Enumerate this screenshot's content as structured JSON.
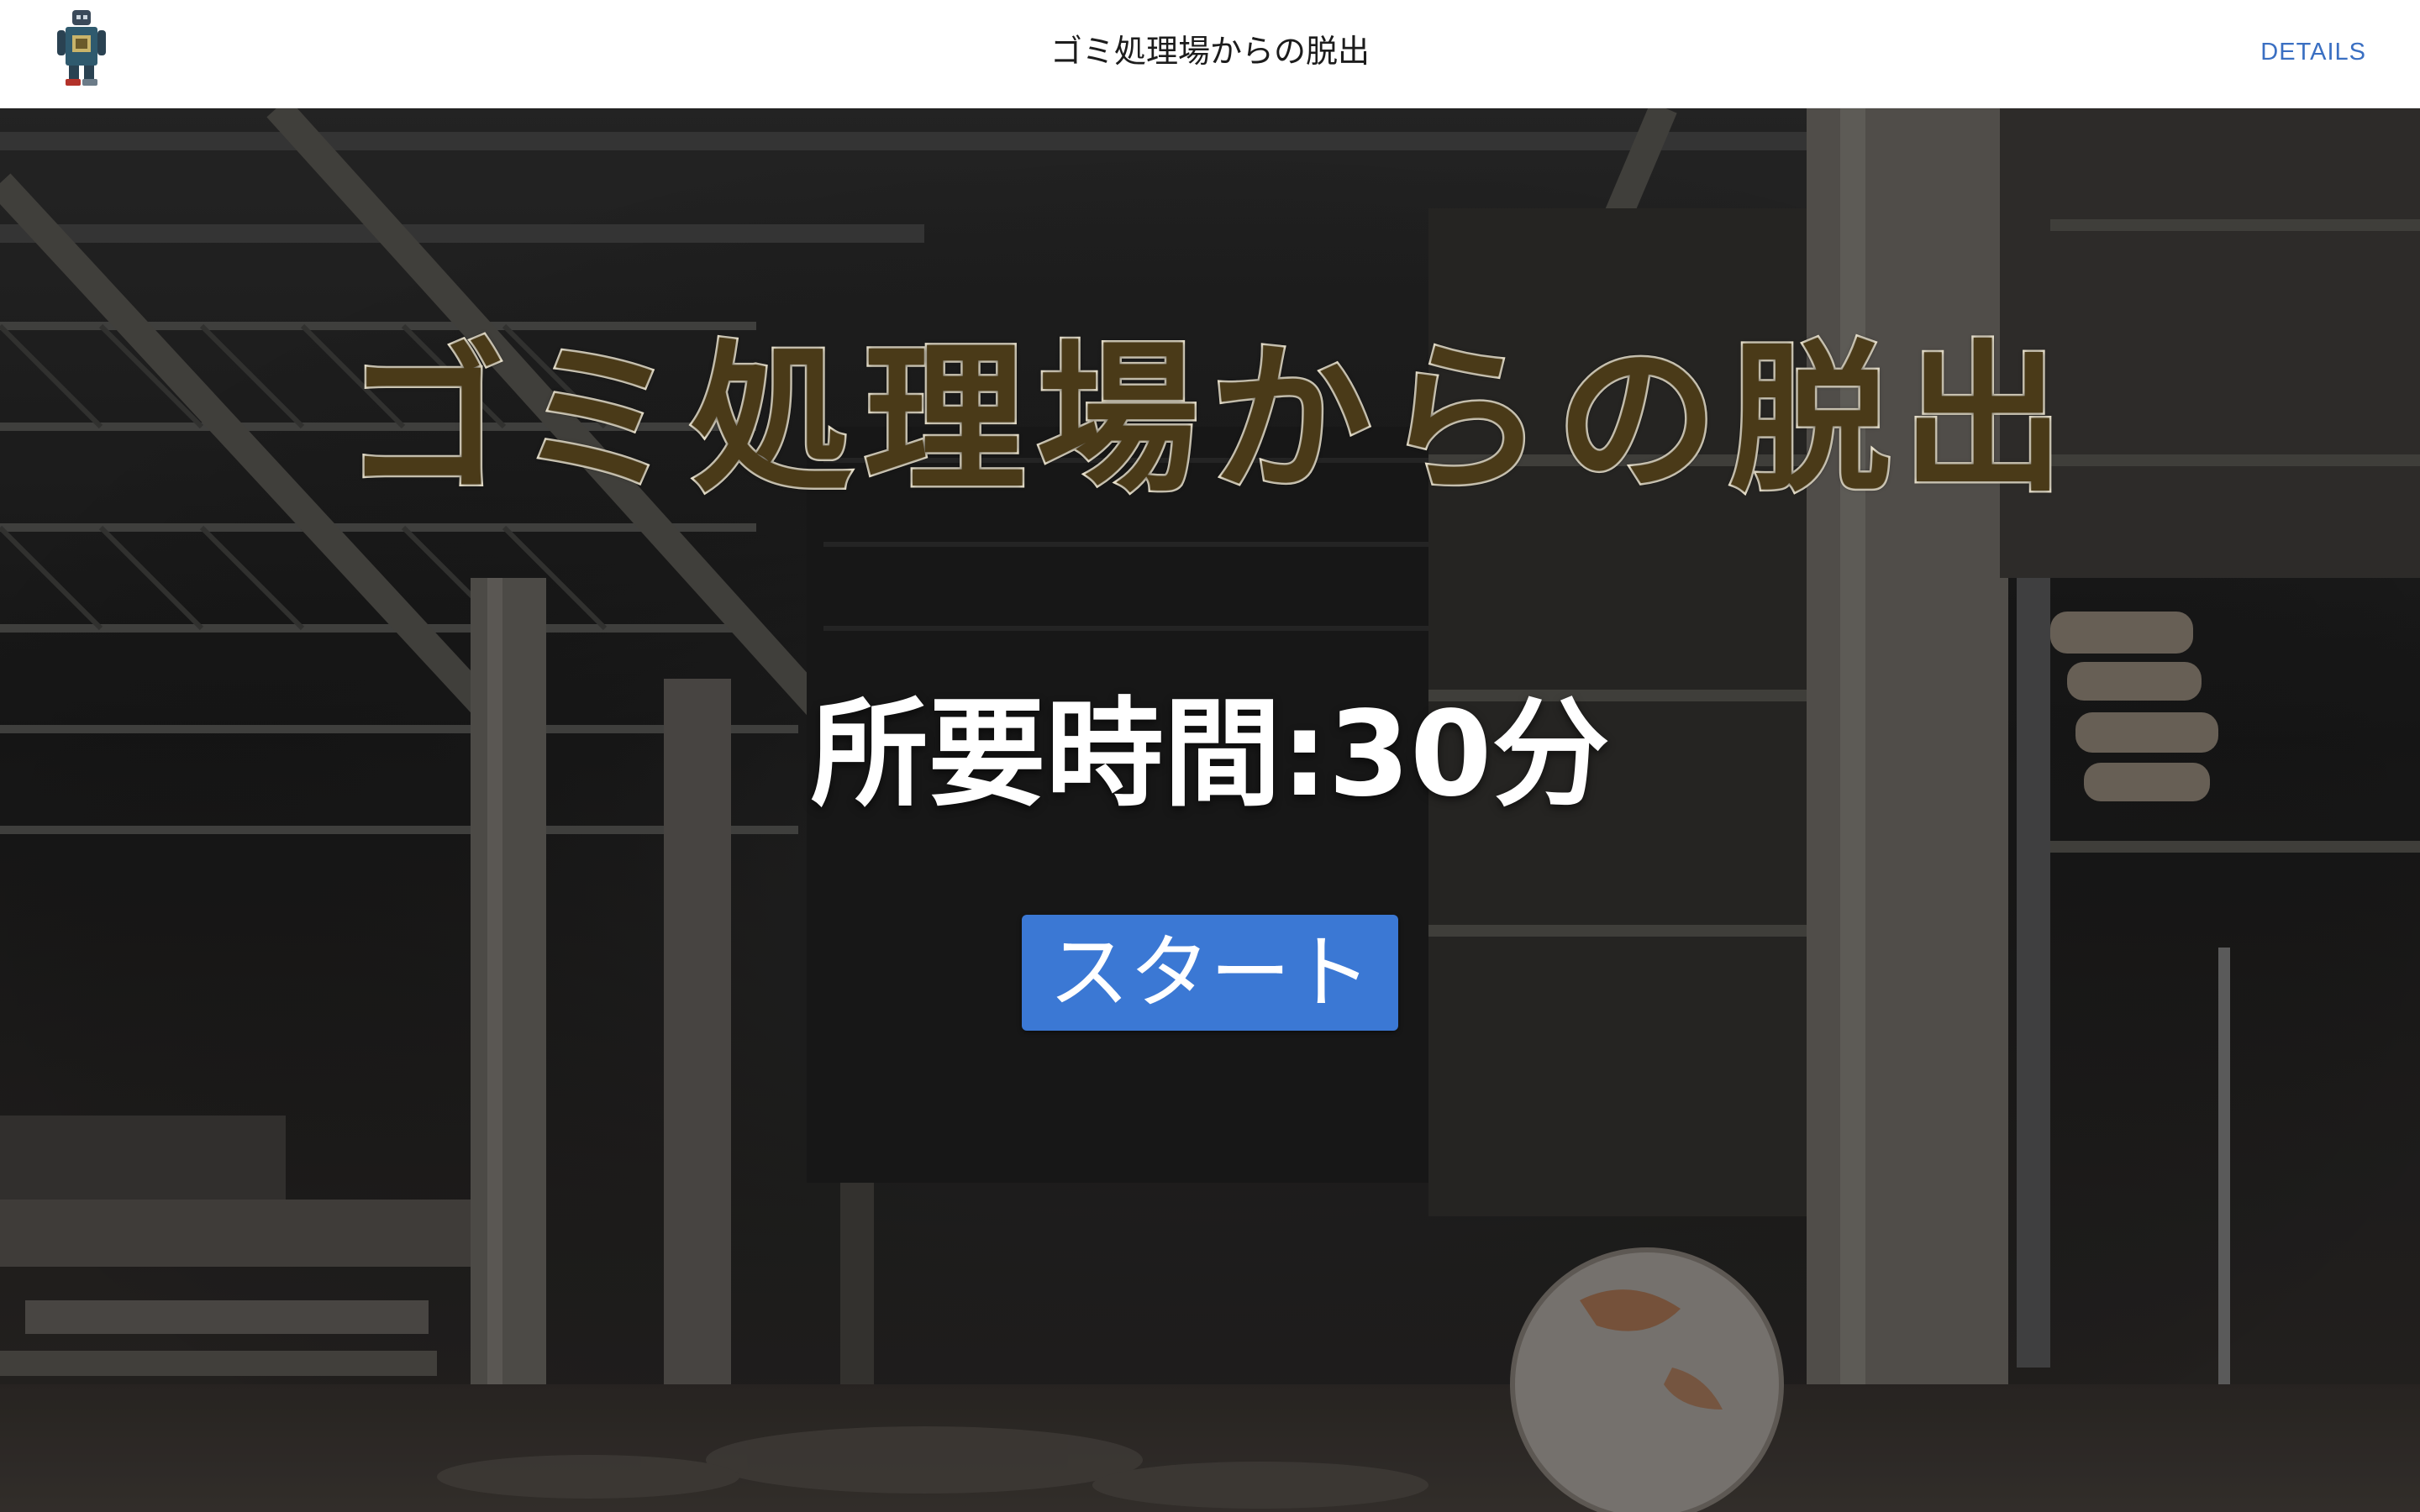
{
  "header": {
    "title": "ゴミ処理場からの脱出",
    "details_label": "DETAILS",
    "app_icon": "robot-icon"
  },
  "main": {
    "game_title": "ゴミ処理場からの脱出",
    "duration_text": "所要時間:30分",
    "start_label": "スタート",
    "background": "abandoned-factory-scene"
  },
  "colors": {
    "header_bg": "#ffffff",
    "link": "#3a6fc2",
    "start_button": "#3b78d4",
    "title_fill": "#4a3a18",
    "title_outline": "#f4ecd6"
  }
}
